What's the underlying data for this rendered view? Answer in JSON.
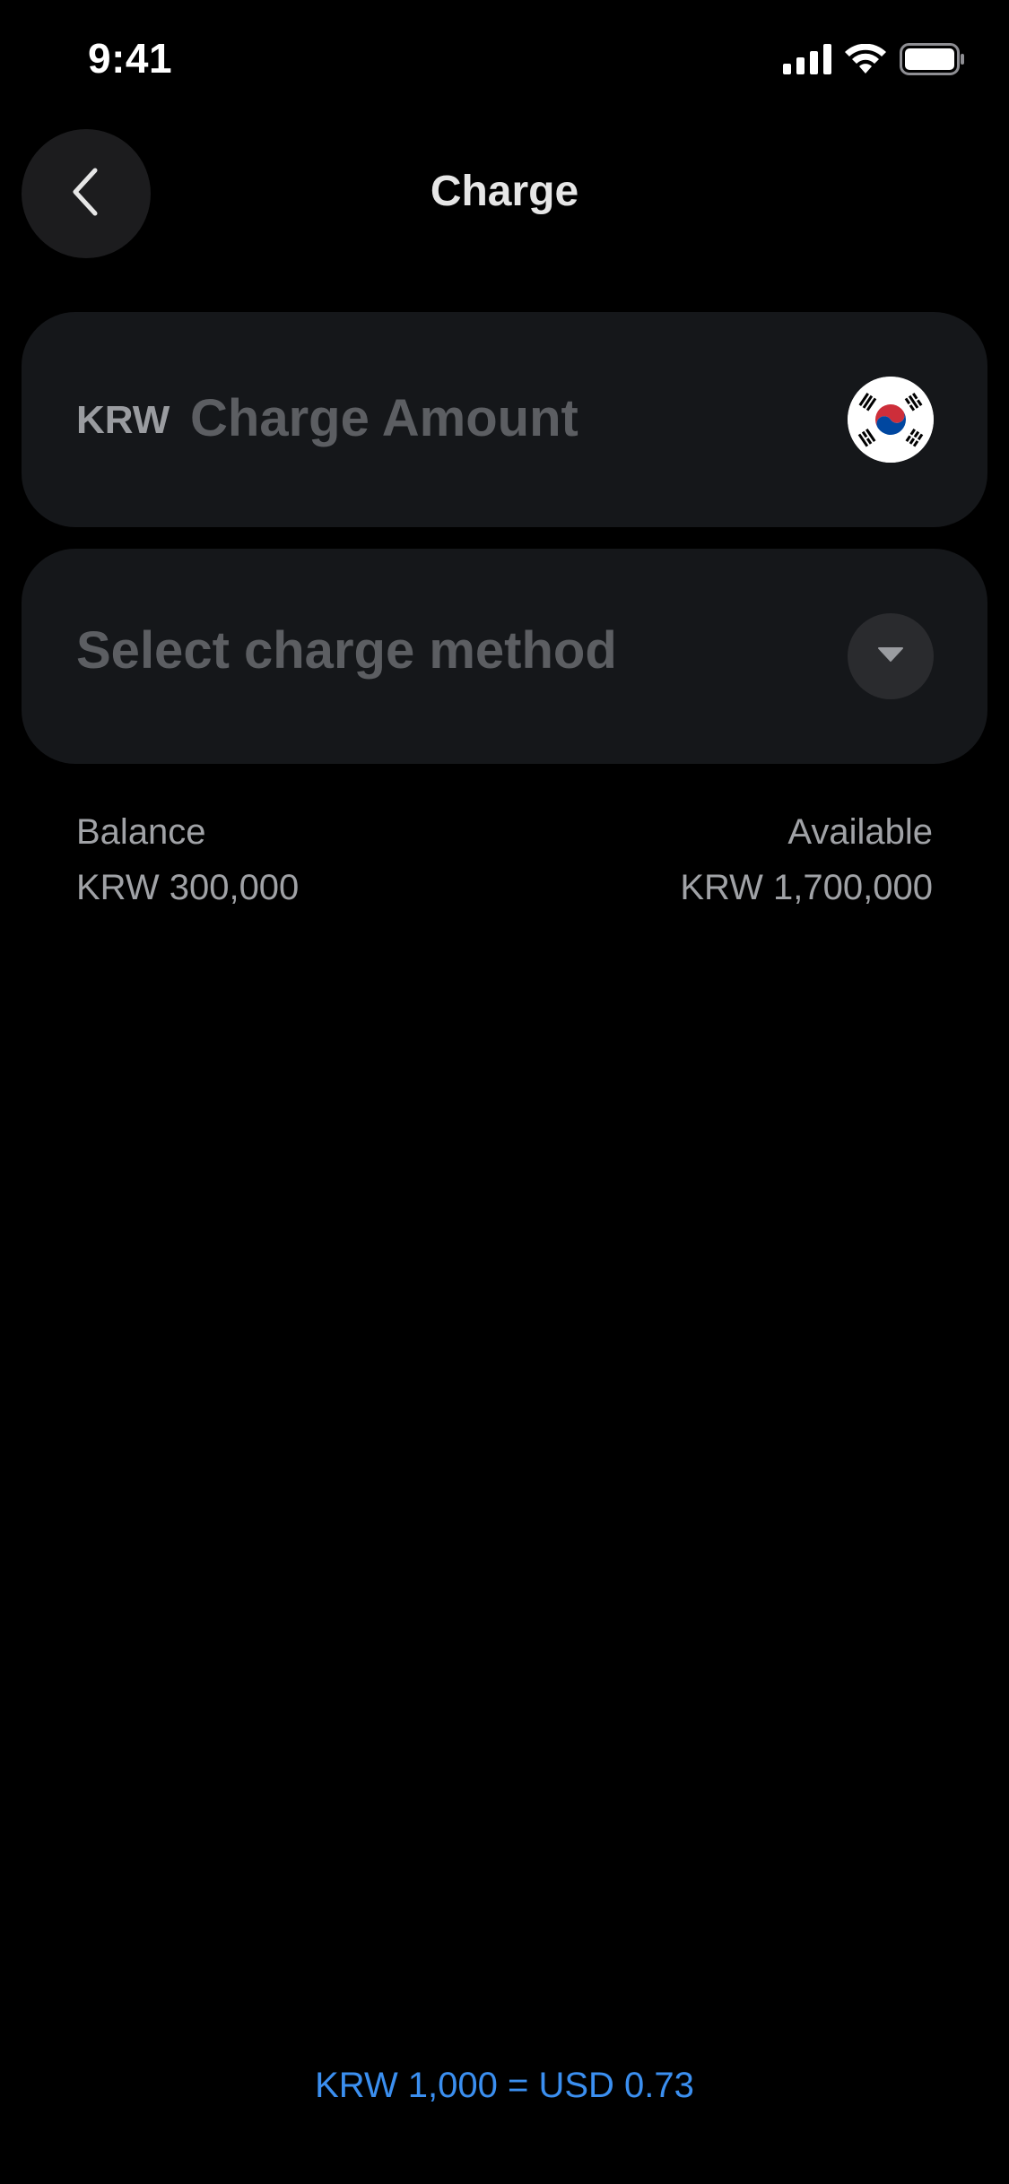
{
  "status_bar": {
    "time": "9:41",
    "icons": [
      "cellular-signal-icon",
      "wifi-icon",
      "battery-icon"
    ]
  },
  "header": {
    "title": "Charge",
    "back_icon": "chevron-left-icon"
  },
  "amount_card": {
    "currency_code": "KRW",
    "input_value": "",
    "input_placeholder": "Charge Amount",
    "flag_icon": "south-korea-flag-icon"
  },
  "method_card": {
    "placeholder": "Select charge method",
    "dropdown_icon": "caret-down-icon"
  },
  "balance": {
    "label": "Balance",
    "value": "KRW 300,000"
  },
  "available": {
    "label": "Available",
    "value": "KRW 1,700,000"
  },
  "exchange_rate": "KRW 1,000 = USD 0.73",
  "colors": {
    "background": "#000000",
    "card": "#15171a",
    "accent": "#3b8ff0",
    "muted_text": "#a0a2a6",
    "placeholder_text": "#5c5e62"
  }
}
